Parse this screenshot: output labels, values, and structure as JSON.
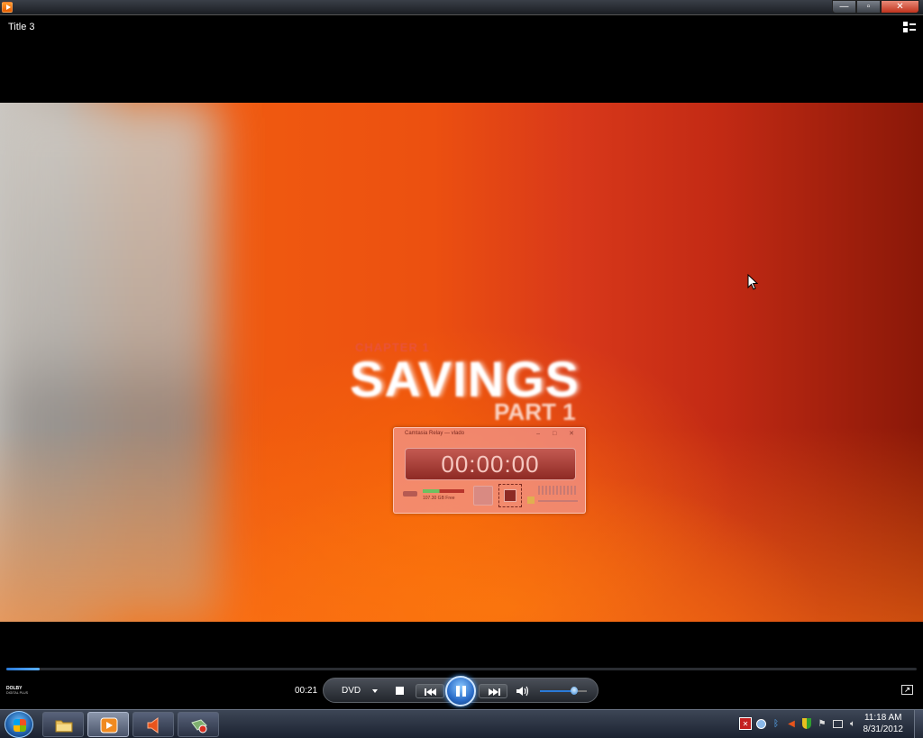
{
  "window": {
    "title_label": "Title 3",
    "controls": {
      "minimize": "—",
      "restore": "▫",
      "close": "✕"
    }
  },
  "video": {
    "chapter_text": "CHAPTER 1",
    "main_text": "SAVINGS",
    "part_text": "PART 1"
  },
  "recorder": {
    "title": "Camtasia Relay — vlado",
    "title_controls": "– □ ✕",
    "timer": "00:00:00",
    "free_space": "107.30 GB Free"
  },
  "player": {
    "elapsed": "00:21",
    "progress_fraction": 0.037,
    "dvd_label": "DVD",
    "volume_fraction": 0.7,
    "dolby_top": "DOLBY",
    "dolby_bottom": "DIGITAL PLUS"
  },
  "taskbar": {
    "clock_time": "11:18 AM",
    "clock_date": "8/31/2012"
  },
  "colors": {
    "accent": "#2a7ad8",
    "video_orange": "#f05a10",
    "video_red": "#c22a14"
  },
  "icons": {
    "switch_view": "switch-to-library-icon",
    "start": "windows-logo-icon",
    "explorer": "folder-icon",
    "media_player": "media-player-icon",
    "speaker_app": "speaker-icon",
    "recorder_app": "recorder-icon"
  }
}
